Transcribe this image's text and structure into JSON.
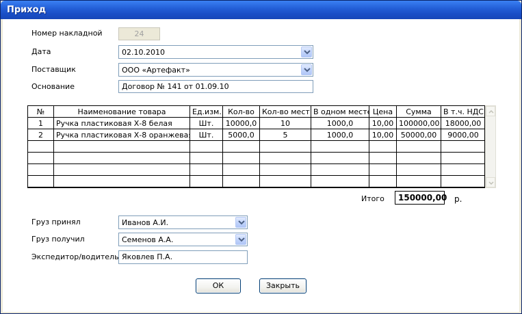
{
  "window": {
    "title": "Приход"
  },
  "form": {
    "invoice_number": {
      "label": "Номер накладной",
      "value": "24"
    },
    "date": {
      "label": "Дата",
      "value": "02.10.2010"
    },
    "supplier": {
      "label": "Поставщик",
      "value": "ООО «Артефакт»"
    },
    "basis": {
      "label": "Основание",
      "value": "Договор № 141 от 01.09.10"
    }
  },
  "table": {
    "headers": [
      "№",
      "Наименование товара",
      "Ед.изм.",
      "Кол-во",
      "Кол-во мест",
      "В одном месте",
      "Цена",
      "Сумма",
      "В т.ч. НДС"
    ],
    "rows": [
      [
        "1",
        "Ручка пластиковая Х-8 белая",
        "Шт.",
        "10000,0",
        "10",
        "1000,0",
        "10,00",
        "100000,00",
        "18000,00"
      ],
      [
        "2",
        "Ручка пластиковая Х-8 оранжевая",
        "Шт.",
        "5000,0",
        "5",
        "1000,0",
        "10,00",
        "50000,00",
        "9000,00"
      ],
      [
        "",
        "",
        "",
        "",
        "",
        "",
        "",
        "",
        ""
      ],
      [
        "",
        "",
        "",
        "",
        "",
        "",
        "",
        "",
        ""
      ],
      [
        "",
        "",
        "",
        "",
        "",
        "",
        "",
        "",
        ""
      ],
      [
        "",
        "",
        "",
        "",
        "",
        "",
        "",
        "",
        ""
      ]
    ]
  },
  "total": {
    "label": "Итого",
    "value": "150000,00",
    "currency": "р."
  },
  "cargo": {
    "accepted": {
      "label": "Груз принял",
      "value": "Иванов А.И."
    },
    "received": {
      "label": "Груз получил",
      "value": "Семенов А.А."
    },
    "driver": {
      "label": "Экспедитор/водитель",
      "value": "Яковлев П.А."
    }
  },
  "buttons": {
    "ok": "ОК",
    "close": "Закрыть"
  },
  "colors": {
    "titlebar": "#2460d8",
    "combo_button": "#c2d4fb",
    "border": "#7f9db9"
  }
}
